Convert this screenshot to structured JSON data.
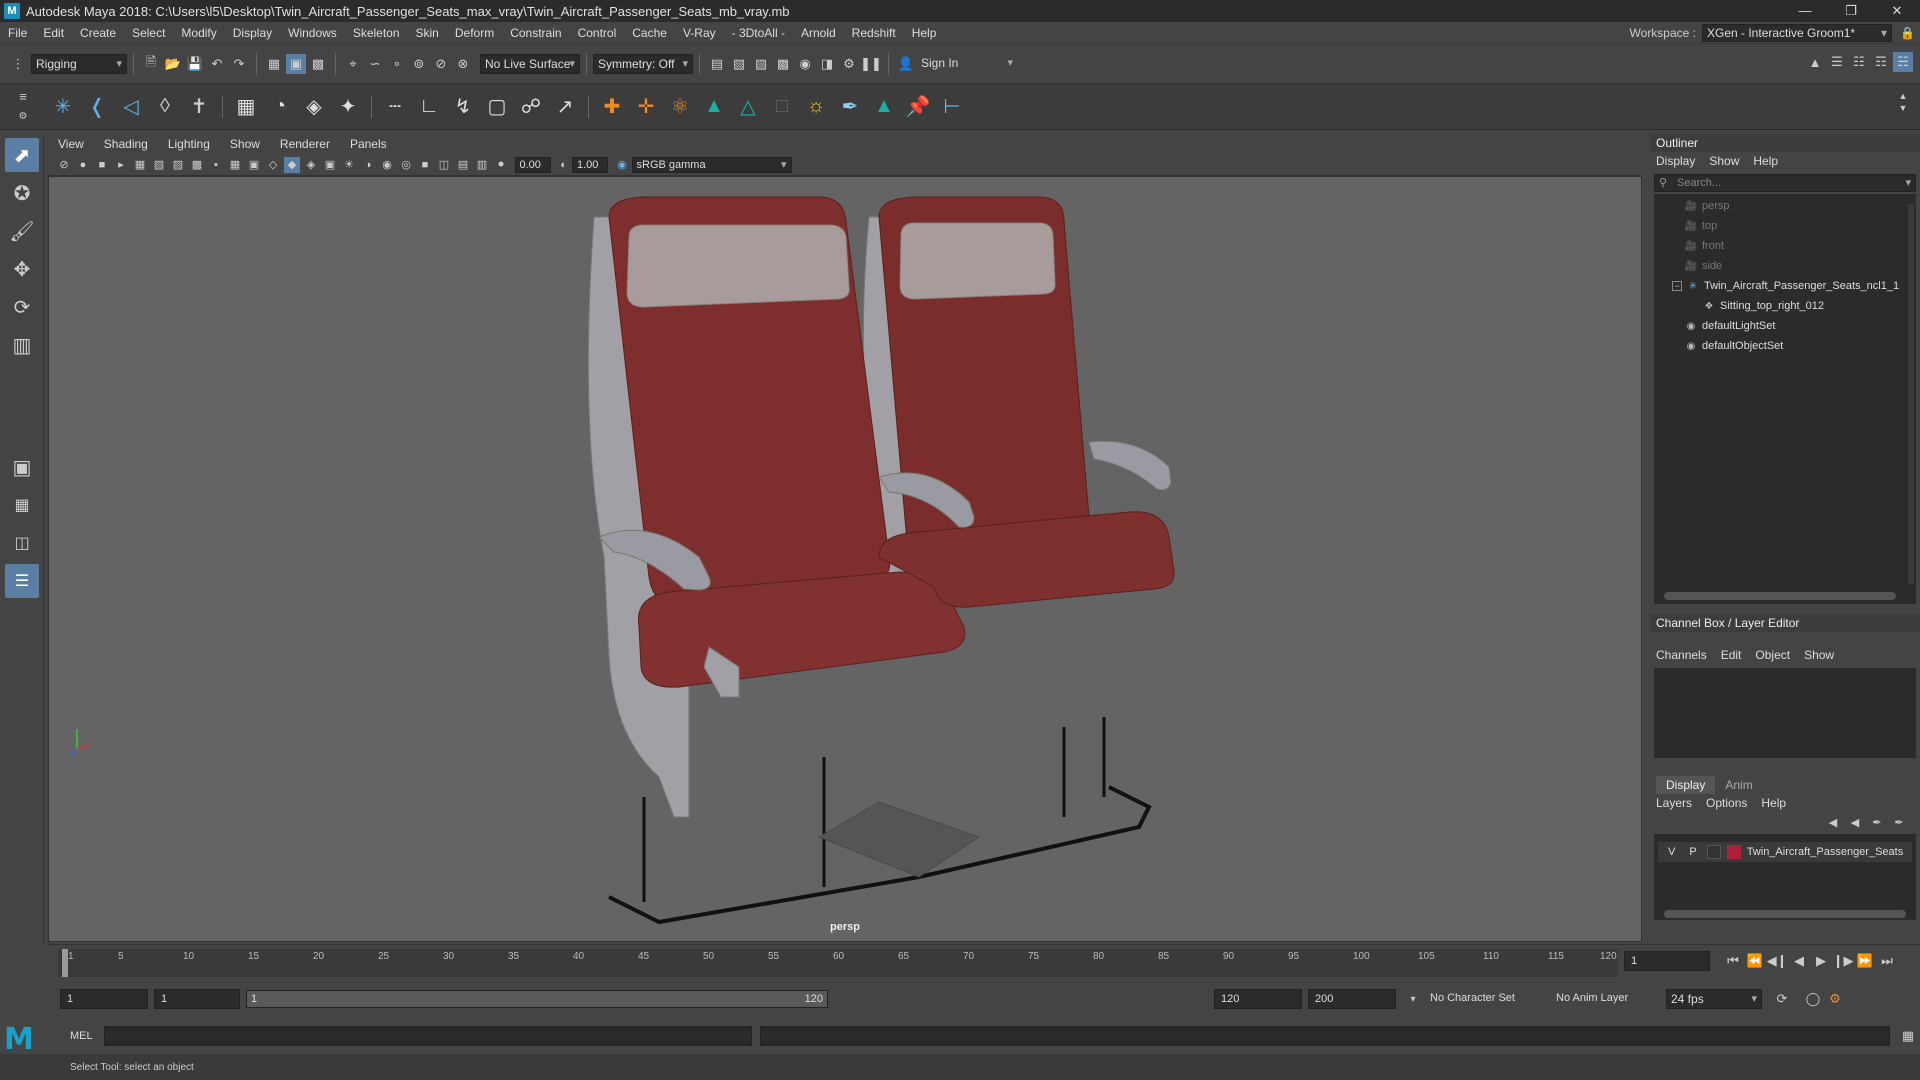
{
  "window": {
    "title": "Autodesk Maya 2018: C:\\Users\\l5\\Desktop\\Twin_Aircraft_Passenger_Seats_max_vray\\Twin_Aircraft_Passenger_Seats_mb_vray.mb",
    "logo_letter": "M"
  },
  "menubar": {
    "items": [
      "File",
      "Edit",
      "Create",
      "Select",
      "Modify",
      "Display",
      "Windows",
      "Skeleton",
      "Skin",
      "Deform",
      "Constrain",
      "Control",
      "Cache",
      "V-Ray",
      "- 3DtoAll -",
      "Arnold",
      "Redshift",
      "Help"
    ],
    "workspace_label": "Workspace :",
    "workspace_value": "XGen - Interactive Groom1*"
  },
  "statusline": {
    "mode": "Rigging",
    "live_surface": "No Live Surface",
    "symmetry": "Symmetry: Off",
    "sign_in": "Sign In"
  },
  "viewport": {
    "menu": [
      "View",
      "Shading",
      "Lighting",
      "Show",
      "Renderer",
      "Panels"
    ],
    "exposure": "0.00",
    "gamma": "1.00",
    "color_space": "sRGB gamma",
    "camera_label": "persp"
  },
  "outliner": {
    "title": "Outliner",
    "menu": [
      "Display",
      "Show",
      "Help"
    ],
    "search_placeholder": "Search...",
    "items": [
      {
        "label": "persp",
        "type": "camera",
        "indent": 0,
        "dim": true
      },
      {
        "label": "top",
        "type": "camera",
        "indent": 0,
        "dim": true
      },
      {
        "label": "front",
        "type": "camera",
        "indent": 0,
        "dim": true
      },
      {
        "label": "side",
        "type": "camera",
        "indent": 0,
        "dim": true
      },
      {
        "label": "Twin_Aircraft_Passenger_Seats_ncl1_1",
        "type": "group",
        "indent": 0,
        "dim": false
      },
      {
        "label": "Sitting_top_right_012",
        "type": "mesh",
        "indent": 1,
        "dim": false
      },
      {
        "label": "defaultLightSet",
        "type": "set",
        "indent": 0,
        "dim": false
      },
      {
        "label": "defaultObjectSet",
        "type": "set",
        "indent": 0,
        "dim": false
      }
    ]
  },
  "channelbox": {
    "title": "Channel Box / Layer Editor",
    "menu": [
      "Channels",
      "Edit",
      "Object",
      "Show"
    ]
  },
  "layereditor": {
    "tabs": [
      "Display",
      "Anim"
    ],
    "menu": [
      "Layers",
      "Options",
      "Help"
    ],
    "layer": {
      "v": "V",
      "p": "P",
      "name": "Twin_Aircraft_Passenger_Seats",
      "color": "#b0203a"
    }
  },
  "timeline": {
    "ticks": [
      "1",
      "5",
      "10",
      "15",
      "20",
      "25",
      "30",
      "35",
      "40",
      "45",
      "50",
      "55",
      "60",
      "65",
      "70",
      "75",
      "80",
      "85",
      "90",
      "95",
      "100",
      "105",
      "110",
      "115",
      "120"
    ],
    "current_frame": "1"
  },
  "range": {
    "start": "1",
    "playback_start": "1",
    "range_left": "1",
    "range_right": "120",
    "playback_end": "120",
    "end": "200",
    "character_set": "No Character Set",
    "anim_layer": "No Anim Layer",
    "fps": "24 fps"
  },
  "cmdline": {
    "label": "MEL"
  },
  "helpline": {
    "text": "Select Tool: select an object"
  }
}
